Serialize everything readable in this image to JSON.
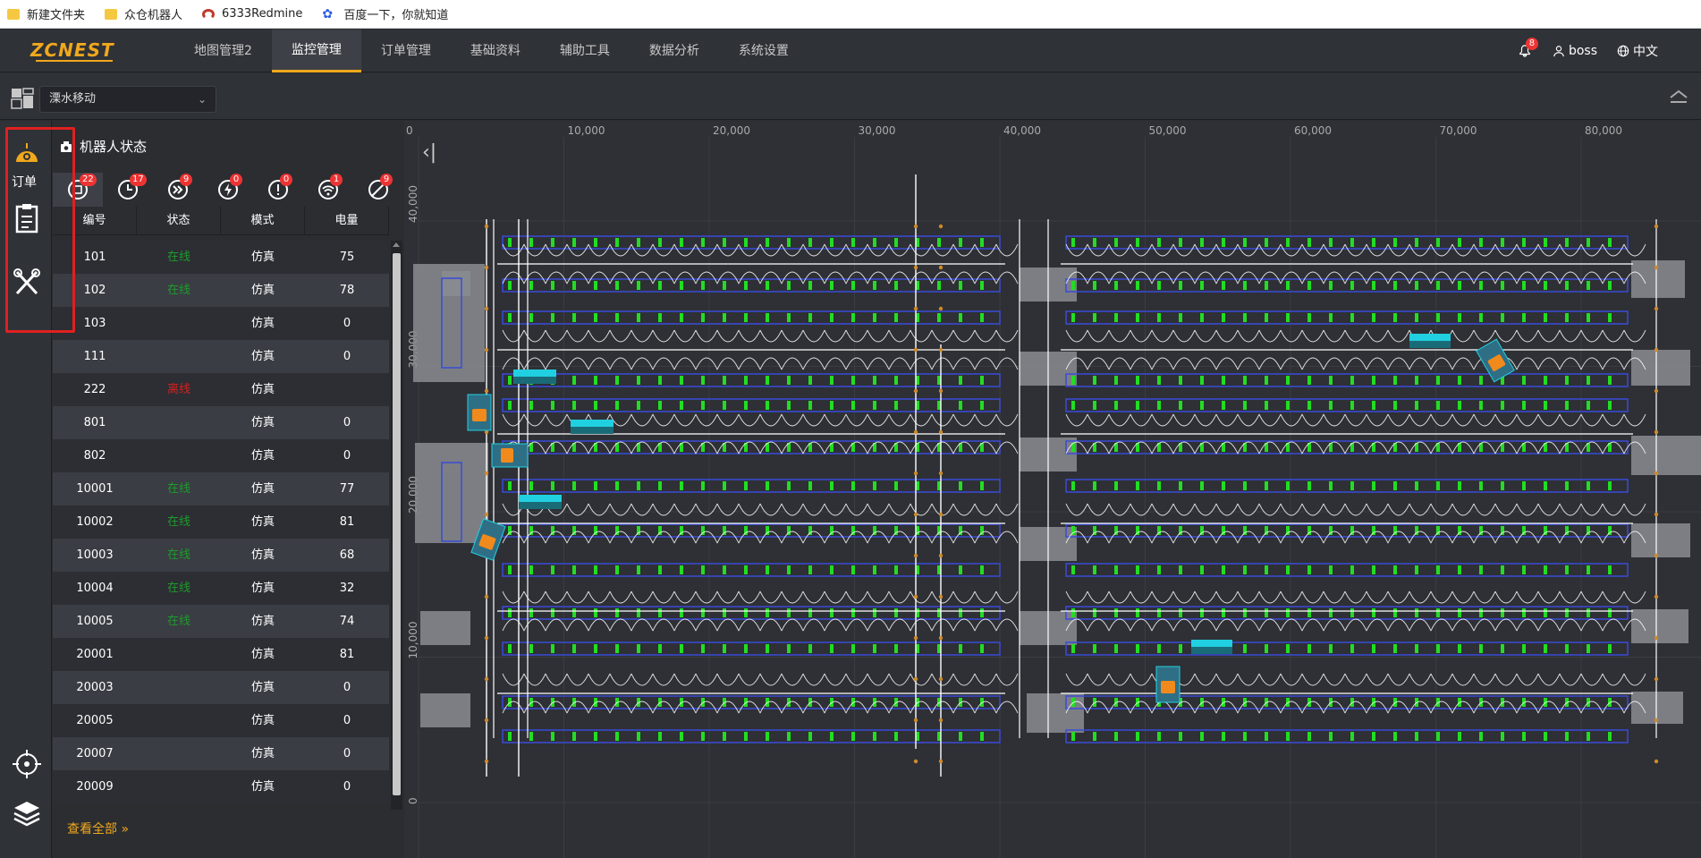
{
  "bookmarks": [
    {
      "label": "新建文件夹",
      "icon": "folder-icon"
    },
    {
      "label": "众仓机器人",
      "icon": "folder-icon"
    },
    {
      "label": "6333Redmine",
      "icon": "redmine-icon"
    },
    {
      "label": "百度一下，你就知道",
      "icon": "baidu-icon"
    }
  ],
  "header": {
    "logo": "ZCNEST",
    "menu": [
      "地图管理2",
      "监控管理",
      "订单管理",
      "基础资料",
      "辅助工具",
      "数据分析",
      "系统设置"
    ],
    "active_menu": "监控管理",
    "notification_count": "8",
    "user": "boss",
    "language": "中文"
  },
  "toolbar": {
    "warehouse_select": "溧水移动"
  },
  "rail": {
    "order_label": "订单"
  },
  "robot_panel": {
    "title": "机器人状态",
    "status_tabs": [
      {
        "icon": "all-robots-icon",
        "count": "22"
      },
      {
        "icon": "clock-icon",
        "count": "17"
      },
      {
        "icon": "fast-forward-icon",
        "count": "9"
      },
      {
        "icon": "charging-icon",
        "count": "0"
      },
      {
        "icon": "alert-icon",
        "count": "0"
      },
      {
        "icon": "signal-icon",
        "count": "1"
      },
      {
        "icon": "disabled-icon",
        "count": "9"
      }
    ],
    "columns": [
      "编号",
      "状态",
      "模式",
      "电量"
    ],
    "rows": [
      {
        "id": "101",
        "status": "在线",
        "status_type": "online",
        "mode": "仿真",
        "battery": "75"
      },
      {
        "id": "102",
        "status": "在线",
        "status_type": "online",
        "mode": "仿真",
        "battery": "78"
      },
      {
        "id": "103",
        "status": "",
        "status_type": "",
        "mode": "仿真",
        "battery": "0"
      },
      {
        "id": "111",
        "status": "",
        "status_type": "",
        "mode": "仿真",
        "battery": "0"
      },
      {
        "id": "222",
        "status": "离线",
        "status_type": "offline",
        "mode": "仿真",
        "battery": ""
      },
      {
        "id": "801",
        "status": "",
        "status_type": "",
        "mode": "仿真",
        "battery": "0"
      },
      {
        "id": "802",
        "status": "",
        "status_type": "",
        "mode": "仿真",
        "battery": "0"
      },
      {
        "id": "10001",
        "status": "在线",
        "status_type": "online",
        "mode": "仿真",
        "battery": "77"
      },
      {
        "id": "10002",
        "status": "在线",
        "status_type": "online",
        "mode": "仿真",
        "battery": "81"
      },
      {
        "id": "10003",
        "status": "在线",
        "status_type": "online",
        "mode": "仿真",
        "battery": "68"
      },
      {
        "id": "10004",
        "status": "在线",
        "status_type": "online",
        "mode": "仿真",
        "battery": "32"
      },
      {
        "id": "10005",
        "status": "在线",
        "status_type": "online",
        "mode": "仿真",
        "battery": "74"
      },
      {
        "id": "20001",
        "status": "",
        "status_type": "",
        "mode": "仿真",
        "battery": "81"
      },
      {
        "id": "20003",
        "status": "",
        "status_type": "",
        "mode": "仿真",
        "battery": "0"
      },
      {
        "id": "20005",
        "status": "",
        "status_type": "",
        "mode": "仿真",
        "battery": "0"
      },
      {
        "id": "20007",
        "status": "",
        "status_type": "",
        "mode": "仿真",
        "battery": "0"
      },
      {
        "id": "20009",
        "status": "",
        "status_type": "",
        "mode": "仿真",
        "battery": "0"
      }
    ],
    "view_all": "查看全部"
  },
  "map": {
    "x_ticks": [
      "0",
      "10,000",
      "20,000",
      "30,000",
      "40,000",
      "50,000",
      "60,000",
      "70,000",
      "80,000"
    ],
    "y_ticks": [
      "40,000",
      "30,000",
      "20,000",
      "10,000",
      "0"
    ],
    "colors": {
      "rack": "#3a4bd8",
      "slot": "#22dd22",
      "path": "#ffffff",
      "robot": "#f08a1c",
      "robot_label": "#21d0e0",
      "grid": "#3a3d42"
    }
  },
  "colors": {
    "accent": "#f0a81c",
    "online": "#1e9b2c",
    "offline": "#d81e1e",
    "badge": "#e33333"
  }
}
